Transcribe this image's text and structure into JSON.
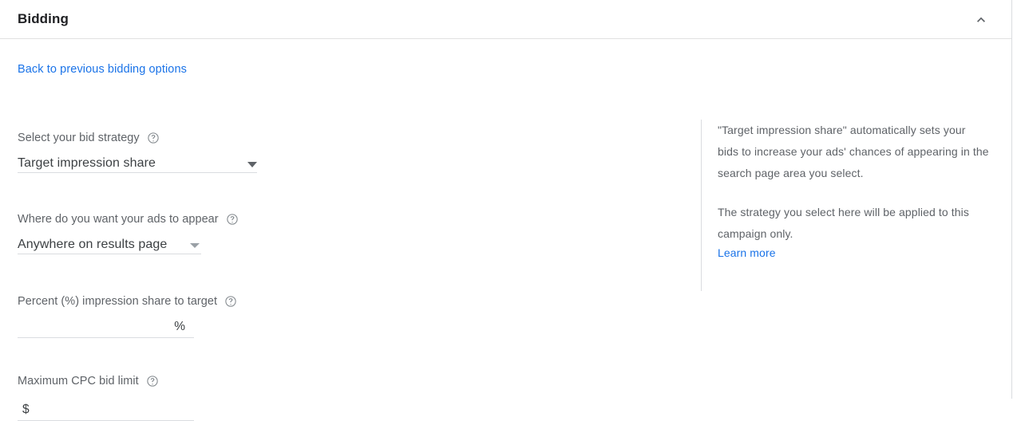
{
  "panel": {
    "title": "Bidding",
    "collapse_icon": "chevron-up-icon"
  },
  "back_link": {
    "label": "Back to previous bidding options"
  },
  "form": {
    "bid_strategy": {
      "label": "Select your bid strategy",
      "help_icon": "help-circle-icon",
      "value": "Target impression share",
      "caret_icon": "chevron-down-icon"
    },
    "ads_appear": {
      "label": "Where do you want your ads to appear",
      "help_icon": "help-circle-icon",
      "value": "Anywhere on results page",
      "caret_icon": "chevron-down-icon"
    },
    "impression_share": {
      "label": "Percent (%) impression share to target",
      "help_icon": "help-circle-icon",
      "value": "",
      "placeholder": "",
      "suffix": "%"
    },
    "max_cpc": {
      "label": "Maximum CPC bid limit",
      "help_icon": "help-circle-icon",
      "value": "",
      "placeholder": "",
      "prefix": "$"
    }
  },
  "info": {
    "paragraph_1": "\"Target impression share\" automatically sets your bids to increase your ads' chances of appearing in the search page area you select.",
    "paragraph_2": "The strategy you select here will be applied to this campaign only.",
    "learn_more": "Learn more"
  },
  "colors": {
    "link": "#1a73e8",
    "label_text": "#5f6368",
    "value_text": "#3c4043",
    "title_text": "#202124",
    "divider": "#dadce0",
    "background": "#ffffff"
  }
}
